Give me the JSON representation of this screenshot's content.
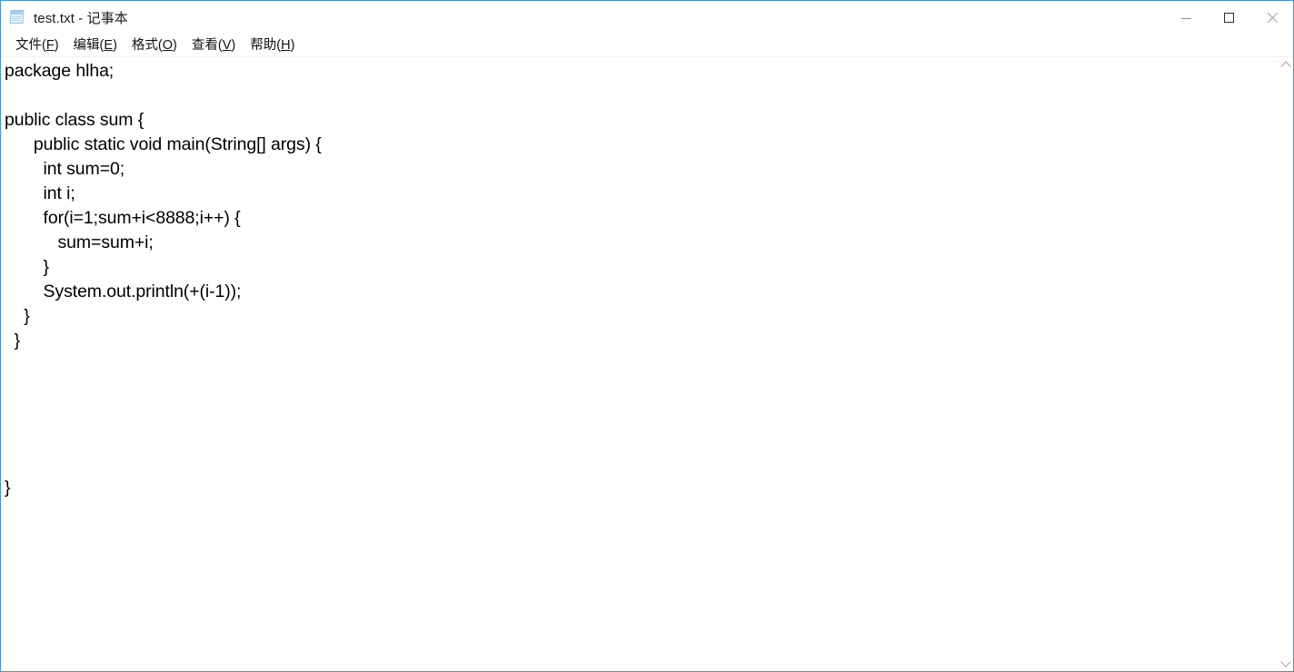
{
  "window": {
    "title": "test.txt - 记事本",
    "icon": "notepad-icon"
  },
  "titlebar_buttons": {
    "minimize": "minimize-icon",
    "maximize": "maximize-icon",
    "close": "close-icon"
  },
  "menubar": {
    "items": [
      {
        "label": "文件",
        "accelerator": "F"
      },
      {
        "label": "编辑",
        "accelerator": "E"
      },
      {
        "label": "格式",
        "accelerator": "O"
      },
      {
        "label": "查看",
        "accelerator": "V"
      },
      {
        "label": "帮助",
        "accelerator": "H"
      }
    ]
  },
  "editor": {
    "lines": [
      "package hlha;",
      "",
      "public class sum {",
      "      public static void main(String[] args) {",
      "        int sum=0;",
      "        int i;",
      "        for(i=1;sum+i<8888;i++) {",
      "           sum=sum+i;",
      "        }",
      "        System.out.println(+(i-1));",
      "    }",
      "  }",
      "",
      "",
      "",
      "",
      "",
      "}"
    ]
  },
  "scrollbar": {
    "up_arrow": "chevron-up-icon",
    "down_arrow": "chevron-down-icon"
  }
}
